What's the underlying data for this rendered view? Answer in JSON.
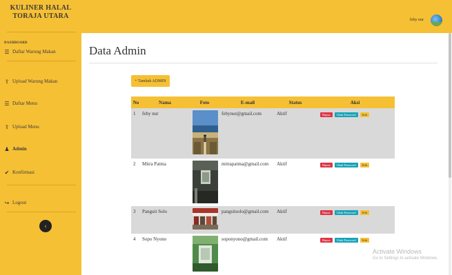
{
  "brand": {
    "line1": "KULINER HALAL",
    "line2": "TORAJA UTARA"
  },
  "sidebar": {
    "heading": "DASHBOARD",
    "items": [
      {
        "label": "Daftar Warung Makan",
        "icon": "list-icon"
      },
      {
        "label": "Upload Warung Makan",
        "icon": "upload-icon"
      },
      {
        "label": "Daftar Menu",
        "icon": "list-icon"
      },
      {
        "label": "Upload Menu",
        "icon": "upload-icon"
      },
      {
        "label": "Admin",
        "icon": "user-icon"
      },
      {
        "label": "Konfirmasi",
        "icon": "check-icon"
      },
      {
        "label": "Logout",
        "icon": "logout-icon"
      }
    ],
    "toggle_icon": "chevron-left-icon"
  },
  "topbar": {
    "user_name": "feby nur",
    "avatar": "avatar-icon"
  },
  "main": {
    "title": "Data Admin",
    "add_button": "+ Tambah ADMIN",
    "table": {
      "headers": [
        "No",
        "Nama",
        "Foto",
        "E-mail",
        "Status",
        "Aksi"
      ],
      "rows": [
        {
          "no": "1",
          "nama": "feby nur",
          "email": "febynur@gmail.com",
          "status": "Aktif"
        },
        {
          "no": "2",
          "nama": "Mitra Patma",
          "email": "mitrapatma@gmail.com",
          "status": "Aktif"
        },
        {
          "no": "3",
          "nama": "Panguit Solo",
          "email": "pangsitsolo@gmail.com",
          "status": "Aktif"
        },
        {
          "no": "4",
          "nama": "Sopo Nyono",
          "email": "soponyono@gmail.com",
          "status": "Aktif"
        }
      ],
      "actions": {
        "delete": "Hapus",
        "change_password": "Ubah Password",
        "edit": "Edit"
      }
    }
  },
  "watermark": {
    "line1": "Activate Windows",
    "line2": "Go to Settings to activate Windows."
  },
  "colors": {
    "accent": "#f6c034",
    "danger": "#dc3545",
    "info": "#17a2b8",
    "row_alt": "#d9d9d9"
  }
}
